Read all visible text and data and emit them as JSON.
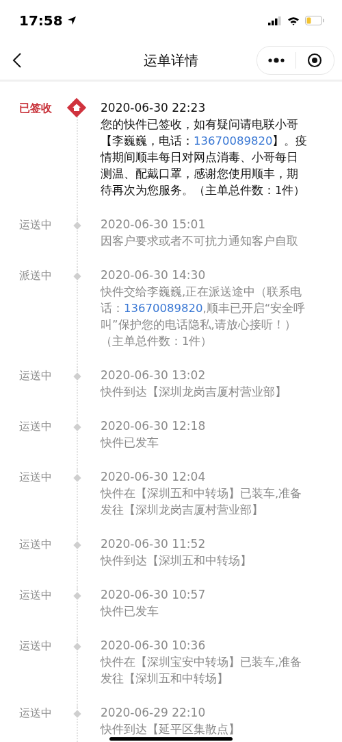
{
  "status_bar": {
    "time": "17:58"
  },
  "nav": {
    "title": "运单详情"
  },
  "entries": [
    {
      "status": "已签收",
      "current": true,
      "time": "2020-06-30 22:23",
      "parts": [
        {
          "kind": "plain",
          "text": "您的快件已签收，如有疑问请电联小哥【李巍巍，电话："
        },
        {
          "kind": "phone",
          "text": "13670089820"
        },
        {
          "kind": "plain",
          "text": "】。疫情期间顺丰每日对网点消毒、小哥每日测温、配戴口罩，感谢您使用顺丰，期待再次为您服务。（主单总件数：1件）"
        }
      ]
    },
    {
      "status": "运送中",
      "current": false,
      "time": "2020-06-30 15:01",
      "parts": [
        {
          "kind": "plain",
          "text": "因客户要求或者不可抗力通知客户自取"
        }
      ]
    },
    {
      "status": "派送中",
      "current": false,
      "time": "2020-06-30 14:30",
      "parts": [
        {
          "kind": "plain",
          "text": "快件交给李巍巍,正在派送途中（联系电话："
        },
        {
          "kind": "phone",
          "text": "13670089820"
        },
        {
          "kind": "plain",
          "text": ",顺丰已开启“安全呼叫”保护您的电话隐私,请放心接听！）（主单总件数：1件）"
        }
      ]
    },
    {
      "status": "运送中",
      "current": false,
      "time": "2020-06-30 13:02",
      "parts": [
        {
          "kind": "plain",
          "text": "快件到达【深圳龙岗吉厦村营业部】"
        }
      ]
    },
    {
      "status": "运送中",
      "current": false,
      "time": "2020-06-30 12:18",
      "parts": [
        {
          "kind": "plain",
          "text": "快件已发车"
        }
      ]
    },
    {
      "status": "运送中",
      "current": false,
      "time": "2020-06-30 12:04",
      "parts": [
        {
          "kind": "plain",
          "text": "快件在【深圳五和中转场】已装车,准备发往【深圳龙岗吉厦村营业部】"
        }
      ]
    },
    {
      "status": "运送中",
      "current": false,
      "time": "2020-06-30 11:52",
      "parts": [
        {
          "kind": "plain",
          "text": "快件到达【深圳五和中转场】"
        }
      ]
    },
    {
      "status": "运送中",
      "current": false,
      "time": "2020-06-30 10:57",
      "parts": [
        {
          "kind": "plain",
          "text": "快件已发车"
        }
      ]
    },
    {
      "status": "运送中",
      "current": false,
      "time": "2020-06-30 10:36",
      "parts": [
        {
          "kind": "plain",
          "text": "快件在【深圳宝安中转场】已装车,准备发往【深圳五和中转场】"
        }
      ]
    },
    {
      "status": "运送中",
      "current": false,
      "time": "2020-06-29 22:10",
      "parts": [
        {
          "kind": "plain",
          "text": "快件到达【延平区集散点】"
        }
      ]
    }
  ]
}
